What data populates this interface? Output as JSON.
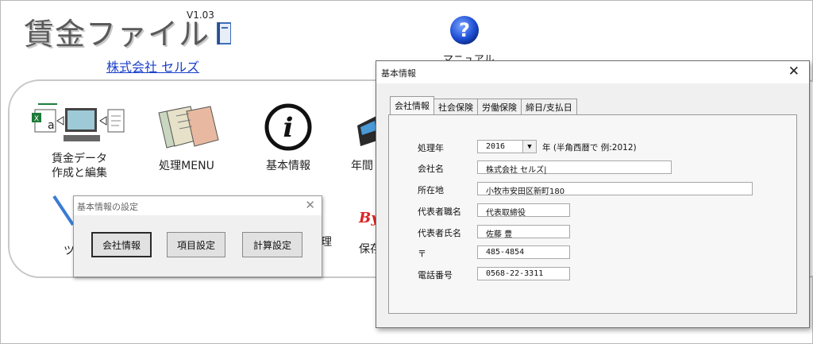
{
  "app": {
    "title": "賃金ファイル",
    "version": "V1.03",
    "company_link": "株式会社 セルズ",
    "manual_label": "マニュアル"
  },
  "menu": {
    "items": [
      {
        "label_line1": "賃金データ",
        "label_line2": "作成と編集"
      },
      {
        "label": "処理MENU"
      },
      {
        "label": "基本情報"
      },
      {
        "label": "年間"
      },
      {
        "label": "ツ"
      },
      {
        "label": "理"
      },
      {
        "label": "保存"
      }
    ]
  },
  "dialog_small": {
    "title": "基本情報の設定",
    "close": "✕",
    "buttons": [
      "会社情報",
      "項目設定",
      "計算設定"
    ]
  },
  "dialog_big": {
    "title": "基本情報",
    "close": "✕",
    "tabs": [
      "会社情報",
      "社会保険",
      "労働保険",
      "締日/支払日"
    ],
    "fields": {
      "year_label": "処理年",
      "year_value": "2016",
      "year_note": "年 (半角西暦で 例:2012)",
      "company_label": "会社名",
      "company_value": "株式会社 セルズ|",
      "address_label": "所在地",
      "address_value": "小牧市安田区新町180",
      "rep_title_label": "代表者職名",
      "rep_title_value": "代表取締役",
      "rep_name_label": "代表者氏名",
      "rep_name_value": "佐藤 豊",
      "zip_label": "〒",
      "zip_value": "485-4854",
      "phone_label": "電話番号",
      "phone_value": "0568-22-3311"
    }
  },
  "icons": [
    "book-icon",
    "help-icon",
    "excel-computer-icon",
    "books-icon",
    "info-icon",
    "register-icon",
    "tool-icon",
    "bye-icon",
    "dropdown-arrow-icon"
  ],
  "colors": {
    "link": "#1a3fc8",
    "help_icon": "#1e4fd6"
  }
}
